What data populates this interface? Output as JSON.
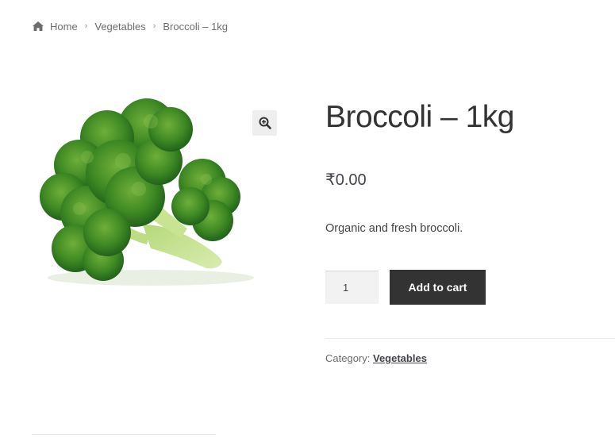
{
  "breadcrumb": {
    "items": [
      "Home",
      "Vegetables",
      "Broccoli – 1kg"
    ],
    "separator": "›",
    "icon": "home-icon"
  },
  "gallery": {
    "image": "broccoli-photo",
    "zoom_icon": "magnifier-plus-icon"
  },
  "product": {
    "title": "Broccoli – 1kg",
    "price": "₹0.00",
    "description": "Organic and fresh broccoli.",
    "quantity": "1",
    "add_to_cart_label": "Add to cart",
    "category_label": "Category:",
    "category_value": "Vegetables"
  },
  "colors": {
    "button_bg": "#333333",
    "button_text": "#ffffff",
    "text": "#43454b",
    "muted": "#6d6d6d"
  }
}
